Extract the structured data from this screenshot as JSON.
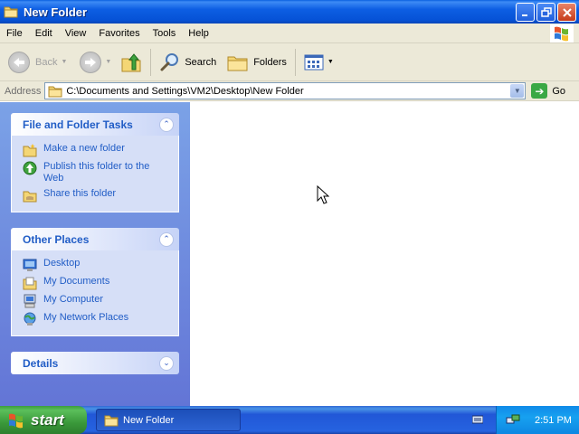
{
  "window": {
    "title": "New Folder",
    "controls": [
      "minimize",
      "maximize",
      "close"
    ]
  },
  "menu": {
    "items": [
      "File",
      "Edit",
      "View",
      "Favorites",
      "Tools",
      "Help"
    ]
  },
  "toolbar": {
    "back_label": "Back",
    "search_label": "Search",
    "folders_label": "Folders"
  },
  "address": {
    "label": "Address",
    "value": "C:\\Documents and Settings\\VM2\\Desktop\\New Folder",
    "go_label": "Go"
  },
  "taskpane": {
    "file_tasks": {
      "title": "File and Folder Tasks",
      "items": [
        {
          "label": "Make a new folder",
          "icon": "new-folder-icon"
        },
        {
          "label": "Publish this folder to the Web",
          "icon": "publish-web-icon"
        },
        {
          "label": "Share this folder",
          "icon": "share-folder-icon"
        }
      ]
    },
    "other_places": {
      "title": "Other Places",
      "items": [
        {
          "label": "Desktop",
          "icon": "desktop-icon"
        },
        {
          "label": "My Documents",
          "icon": "my-documents-icon"
        },
        {
          "label": "My Computer",
          "icon": "my-computer-icon"
        },
        {
          "label": "My Network Places",
          "icon": "network-places-icon"
        }
      ]
    },
    "details": {
      "title": "Details"
    }
  },
  "taskbar": {
    "start_label": "start",
    "window_button": "New Folder",
    "clock": "2:51 PM"
  },
  "colors": {
    "title_blue": "#0652d6",
    "task_link": "#215dc6",
    "start_green": "#3a993a"
  }
}
